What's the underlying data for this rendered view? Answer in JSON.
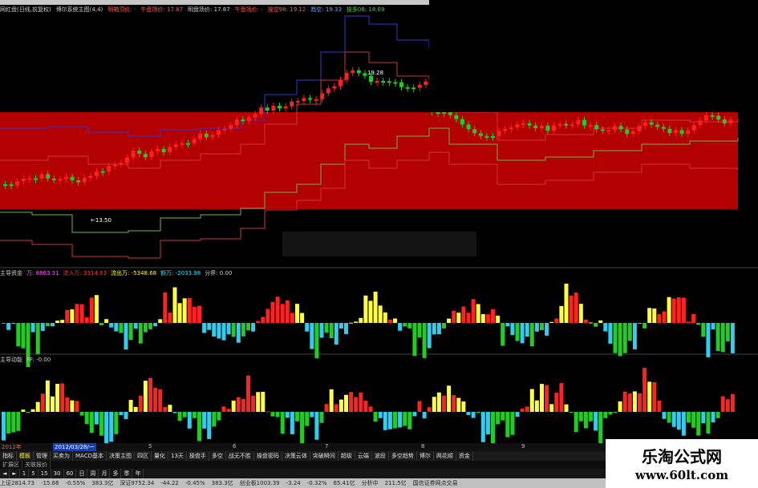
{
  "window": {
    "kline_info": [
      {
        "text": "网红盘(日线,前复权)",
        "color": "#cccccc"
      },
      {
        "text": "博尔系统主图(4,4)",
        "color": "#cccccc"
      },
      {
        "text": "明箱顶价: -",
        "color": "#ff5555"
      },
      {
        "text": "午盘场价: 17.87",
        "color": "#ff5555"
      },
      {
        "text": "明盘场价: 17.87",
        "color": "#cccccc"
      },
      {
        "text": "午盘场价: -",
        "color": "#ff5555"
      },
      {
        "text": "操空98: 19.12",
        "color": "#ff5555"
      },
      {
        "text": "趋空: 19.33",
        "color": "#55aaff"
      },
      {
        "text": "操多08: 18.69",
        "color": "#33dd33"
      }
    ],
    "price_high_label": "19.28",
    "price_low_label": "←13.50"
  },
  "indicator1": {
    "title": [
      {
        "text": "主导资金",
        "color": "#cccccc"
      },
      {
        "text": "万: 8863.31",
        "color": "#ff55ff"
      },
      {
        "text": "流入万: 3314.63",
        "color": "#ff3333"
      },
      {
        "text": "流出万: -5348.68",
        "color": "#ffff00"
      },
      {
        "text": "额万: -2033.98",
        "color": "#33ddff"
      },
      {
        "text": "分界: 0.00",
        "color": "#cccccc"
      }
    ]
  },
  "indicator2": {
    "title": [
      {
        "text": "主导动能",
        "color": "#cccccc"
      },
      {
        "text": "FF: -0.00",
        "color": "#cccccc"
      }
    ]
  },
  "timeline": {
    "year": "2012年",
    "cursor_date": "2012/03/28/一",
    "months": [
      "5",
      "6",
      "7",
      "8",
      "9"
    ]
  },
  "tabs": [
    "指标",
    "模板",
    "管理",
    "买卖为",
    "MACD基本",
    "决策主图",
    "四区",
    "量化",
    "13天",
    "操盘手",
    "多空",
    "战无不胜",
    "操盘密码",
    "决策云体",
    "突破瞬间",
    "超级",
    "云端",
    "波段",
    "多空趋势",
    "博尔",
    "两花顺",
    "资金"
  ],
  "selected_tab": 1,
  "subtabs": [
    "扩展区",
    "关联报价"
  ],
  "toolbar": [
    "◄",
    "►",
    "1",
    "5",
    "15",
    "30",
    "60",
    "日",
    "周",
    "月",
    "多",
    "季",
    "年"
  ],
  "statusbar": [
    "上证2814.73",
    "-15.66",
    "-0.55%",
    "383.3亿",
    "深证9752.34",
    "-44.22",
    "-0.45%",
    "383.3亿",
    "创业板1003.39",
    "-3.24",
    "-0.32%",
    "65.41亿",
    "分析中",
    "211.5亿",
    "国信证券网点交易"
  ],
  "watermark": {
    "cn": "乐淘公式网",
    "url": "www.60lt.com"
  },
  "colors": {
    "band_fill": "#b30000",
    "up_candle": "#ff2020",
    "down_candle": "#22cc22",
    "hist_up": "#ff2222",
    "hist_up2": "#ffff44",
    "hist_down": "#22cc22",
    "hist_down2": "#33ccee",
    "line_blue": "#3333dd",
    "line_red": "#cc3344",
    "line_green": "#66bb44"
  }
}
